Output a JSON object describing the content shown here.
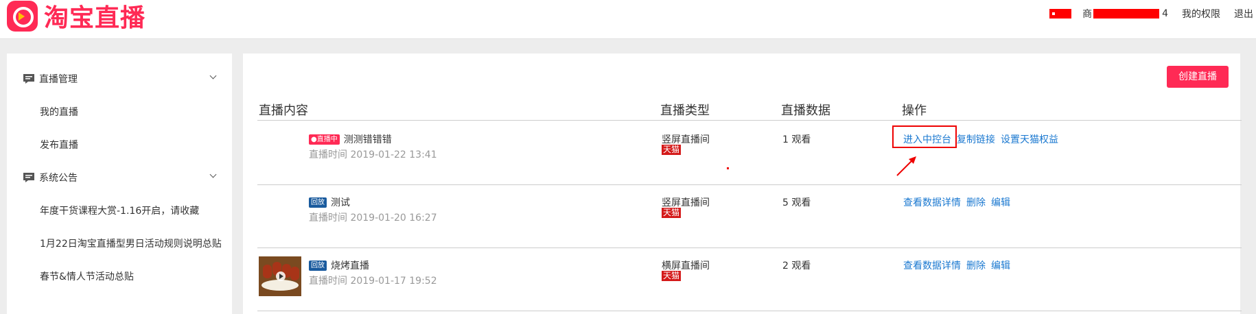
{
  "header": {
    "logo_text": "淘宝直播",
    "shop_prefix": "商",
    "shop_suffix": "4",
    "my_permissions": "我的权限",
    "logout": "退出"
  },
  "sidebar": {
    "groups": [
      {
        "title": "直播管理",
        "items": [
          "我的直播",
          "发布直播"
        ]
      },
      {
        "title": "系统公告",
        "items": [
          "年度干货课程大赏-1.16开启，请收藏",
          "1月22日淘宝直播型男日活动规则说明总贴",
          "春节&情人节活动总贴"
        ]
      }
    ]
  },
  "main": {
    "create_button": "创建直播",
    "columns": [
      "直播内容",
      "直播类型",
      "直播数据",
      "操作"
    ],
    "rows": [
      {
        "badge": "●直播中",
        "badge_type": "live",
        "title": "测测错错错",
        "time": "直播时间 2019-01-22 13:41",
        "type": "竖屏直播间",
        "tag": "天猫",
        "views": "1 观看",
        "actions": [
          "进入中控台",
          "复制链接",
          "设置天猫权益"
        ],
        "has_thumb": false
      },
      {
        "badge": "回放",
        "badge_type": "replay",
        "title": "测试",
        "time": "直播时间 2019-01-20 16:27",
        "type": "竖屏直播间",
        "tag": "天猫",
        "views": "5 观看",
        "actions": [
          "查看数据详情",
          "删除",
          "编辑"
        ],
        "has_thumb": false
      },
      {
        "badge": "回放",
        "badge_type": "replay",
        "title": "烧烤直播",
        "time": "直播时间 2019-01-17 19:52",
        "type": "横屏直播间",
        "tag": "天猫",
        "views": "2 观看",
        "actions": [
          "查看数据详情",
          "删除",
          "编辑"
        ],
        "has_thumb": true
      }
    ]
  },
  "colors": {
    "brand": "#ff2a55",
    "link": "#1a78d0",
    "tmall": "#d41a1a",
    "replay_badge": "#1a5b9e",
    "annotation": "#ee0000"
  },
  "icons": [
    "logo-icon",
    "announcement-icon",
    "chevron-down-icon",
    "play-icon"
  ]
}
